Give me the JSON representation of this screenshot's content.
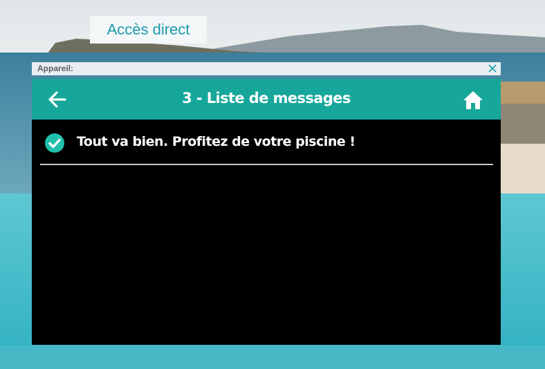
{
  "access_tab": {
    "label": "Accès direct"
  },
  "device_bar": {
    "label": "Appareil:"
  },
  "screen": {
    "title": "3 - Liste de messages",
    "back_icon": "arrow-left-icon",
    "home_icon": "home-icon",
    "messages": [
      {
        "icon": "check-circle-icon",
        "text": "Tout va bien. Profitez de votre piscine !"
      }
    ]
  },
  "colors": {
    "accent": "#16a79a",
    "tab_text": "#1a9bab",
    "screen_bg": "#000000"
  }
}
